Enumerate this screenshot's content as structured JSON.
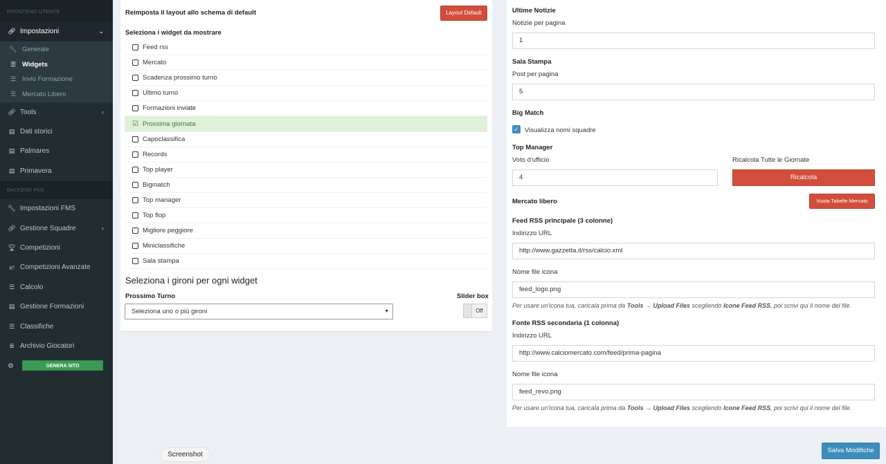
{
  "sidebar": {
    "header_frontend": "FRONTEND UTENTE",
    "impostazioni": "Impostazioni",
    "sub": [
      "Generale",
      "Widgets",
      "Invio Formazione",
      "Mercato Libero"
    ],
    "tools": "Tools",
    "dati_storici": "Dati storici",
    "palmares": "Palmares",
    "primavera": "Primavera",
    "header_backend": "BACKEND FMS",
    "backend": [
      "Impostazioni FMS",
      "Gestione Squadre",
      "Competizioni",
      "Competizioni Avanzate",
      "Calcolo",
      "Gestione Formazioni",
      "Classifiche",
      "Archivio Giocatori"
    ],
    "genera_sito": "GENERA SITO"
  },
  "left": {
    "reset_label": "Reimposta il layout allo schema di default",
    "layout_default_btn": "Layout Default",
    "select_widgets_label": "Seleziona i widget da mostrare",
    "widgets": [
      {
        "label": "Feed rss",
        "checked": false
      },
      {
        "label": "Mercato",
        "checked": false
      },
      {
        "label": "Scadenza prossimo turno",
        "checked": false
      },
      {
        "label": "Ultimo turno",
        "checked": false
      },
      {
        "label": "Formazioni inviate",
        "checked": false
      },
      {
        "label": "Prossima giornata",
        "checked": true
      },
      {
        "label": "Capoclassifica",
        "checked": false
      },
      {
        "label": "Records",
        "checked": false
      },
      {
        "label": "Top player",
        "checked": false
      },
      {
        "label": "Bigmatch",
        "checked": false
      },
      {
        "label": "Top manager",
        "checked": false
      },
      {
        "label": "Top flop",
        "checked": false
      },
      {
        "label": "Migliore peggiore",
        "checked": false
      },
      {
        "label": "Miniclassifiche",
        "checked": false
      },
      {
        "label": "Sala stampa",
        "checked": false
      }
    ],
    "gironi_title": "Seleziona i gironi per ogni widget",
    "prossimo_turno": "Prossimo Turno",
    "slider_box": "Slider box",
    "select_placeholder": "Seleziona uno o più gironi",
    "toggle_off": "Off"
  },
  "right": {
    "ultime_notizie": "Ultime Notizie",
    "notizie_per_pagina": "Notizie per pagina",
    "notizie_value": "1",
    "sala_stampa": "Sala Stampa",
    "post_per_pagina": "Post per pagina",
    "post_value": "5",
    "big_match": "Big Match",
    "visualizza_nomi": "Visualizza nomi squadre",
    "top_manager": "Top Manager",
    "voto_ufficio": "Voto d'ufficio",
    "voto_value": "4",
    "ricalcola_tutte": "Ricalcola Tutte le Giornate",
    "ricalcola_btn": "Ricalcola",
    "mercato_libero": "Mercato libero",
    "vuota_btn": "Vuota Tabelle Mercato",
    "feed_principale": "Feed RSS principale (3 colonne)",
    "indirizzo_url": "Indirizzo URL",
    "feed1_url": "http://www.gazzetta.it/rss/calcio.xml",
    "nome_file_icona": "Nome file icona",
    "feed1_icon": "feed_logo.png",
    "help_a": "Per usare un'icona tua, caricala prima da ",
    "help_tools": "Tools",
    "help_arrow": " → ",
    "help_upload": "Upload Files",
    "help_b": " scegliendo ",
    "help_icone": "Icone Feed RSS",
    "help_c": ", poi scrivi qui il nome del file.",
    "fonte_secondaria": "Fonte RSS secondaria (1 colonna)",
    "feed2_url": "http://www.calciomercato.com/feed/prima-pagina",
    "feed2_icon": "feed_revo.png"
  },
  "footer": {
    "salva": "Salva Modifiche",
    "screenshot": "Screenshot"
  },
  "colors": {
    "accent": "#3c8dbc",
    "danger": "#d24e3c",
    "success": "#3c9a55",
    "sidebar": "#222d32"
  }
}
